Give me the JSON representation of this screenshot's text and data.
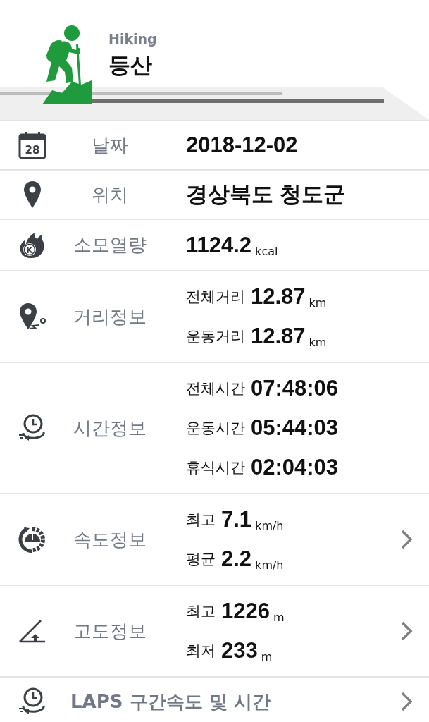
{
  "header": {
    "subtitle": "Hiking",
    "title": "등산"
  },
  "rows": [
    {
      "kind": "single",
      "label": "날짜",
      "icon_text": "28",
      "value": "2018-12-02",
      "has_arrow": false
    },
    {
      "kind": "single",
      "label": "위치",
      "value": "경상북도 청도군",
      "has_arrow": false
    },
    {
      "kind": "single",
      "label": "소모열량",
      "icon_text": "K",
      "value": "1124.2",
      "unit": "kcal",
      "has_arrow": false
    },
    {
      "kind": "multi",
      "label": "거리정보",
      "has_arrow": false,
      "lines": [
        {
          "label": "전체거리",
          "value": "12.87",
          "unit": "km"
        },
        {
          "label": "운동거리",
          "value": "12.87",
          "unit": "km"
        }
      ]
    },
    {
      "kind": "multi",
      "label": "시간정보",
      "has_arrow": false,
      "lines": [
        {
          "label": "전체시간",
          "value": "07:48:06"
        },
        {
          "label": "운동시간",
          "value": "05:44:03"
        },
        {
          "label": "휴식시간",
          "value": "02:04:03"
        }
      ]
    },
    {
      "kind": "multi",
      "label": "속도정보",
      "has_arrow": true,
      "lines": [
        {
          "label": "최고",
          "value": "7.1",
          "unit": "km/h"
        },
        {
          "label": "평균",
          "value": "2.2",
          "unit": "km/h"
        }
      ]
    },
    {
      "kind": "multi",
      "label": "고도정보",
      "has_arrow": true,
      "lines": [
        {
          "label": "최고",
          "value": "1226",
          "unit": "m"
        },
        {
          "label": "최저",
          "value": "233",
          "unit": "m"
        }
      ]
    },
    {
      "kind": "wide",
      "label": "LAPS 구간속도 및 시간",
      "has_arrow": true
    }
  ]
}
